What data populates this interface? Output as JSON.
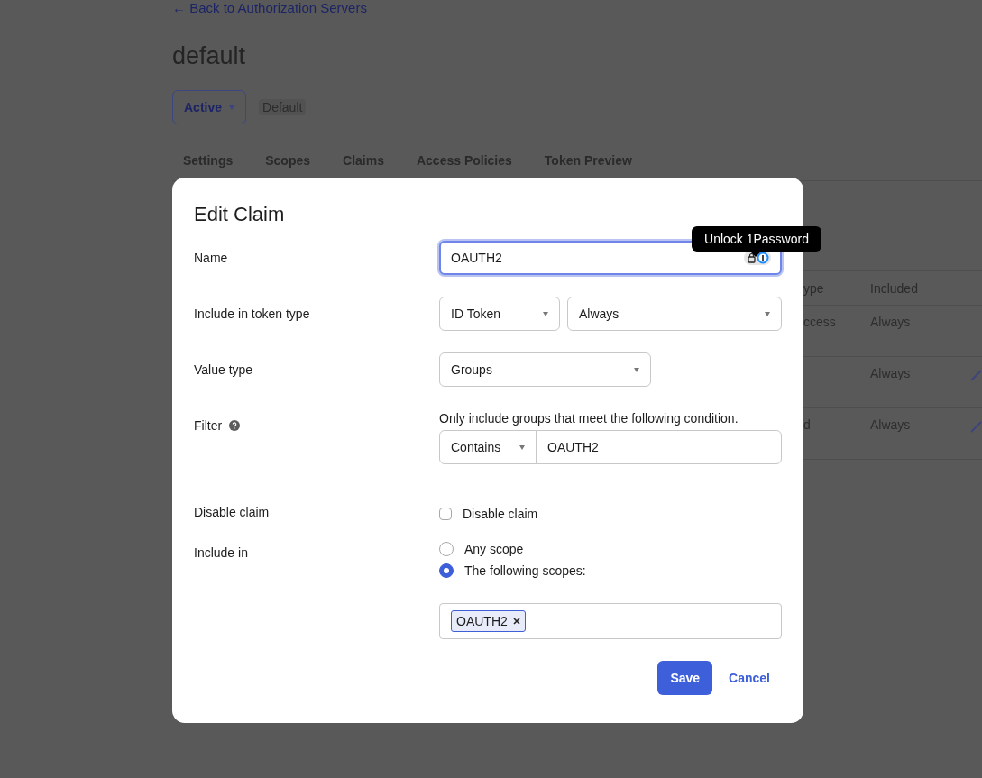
{
  "page": {
    "back_link": "← Back to Authorization Servers",
    "title": "default",
    "status_dropdown": "Active",
    "badge": "Default",
    "tabs": [
      {
        "label": "Settings",
        "selected": false
      },
      {
        "label": "Scopes",
        "selected": false
      },
      {
        "label": "Claims",
        "selected": false
      },
      {
        "label": "Access Policies",
        "selected": false
      },
      {
        "label": "Token Preview",
        "selected": false
      }
    ],
    "table": {
      "columns": [
        "ype",
        "Included"
      ],
      "rows": [
        {
          "column_1": "ccess",
          "included": "Always",
          "edit_icon": false
        },
        {
          "included": "Always",
          "edit_icon": true
        },
        {
          "column_1": "d",
          "included": "Always",
          "edit_icon": true
        }
      ]
    }
  },
  "modal": {
    "title": "Edit Claim",
    "name": {
      "label": "Name",
      "value": "OAUTH2",
      "focused": true
    },
    "token_type": {
      "label": "Include in token type",
      "token": "ID Token",
      "when": "Always"
    },
    "value_type": {
      "label": "Value type",
      "value": "Groups"
    },
    "filter": {
      "label": "Filter",
      "hint": "Only include groups that meet the following condition.",
      "operator": "Contains",
      "value": "OAUTH2"
    },
    "disable_claim": {
      "label": "Disable claim",
      "checkbox_label": "Disable claim",
      "checked": false
    },
    "include_in": {
      "label": "Include in",
      "options": [
        {
          "label": "Any scope",
          "selected": false
        },
        {
          "label": "The following scopes:",
          "selected": true
        }
      ],
      "scopes": [
        "OAUTH2"
      ]
    },
    "buttons": {
      "save": "Save",
      "cancel": "Cancel"
    }
  },
  "tooltip": "Unlock 1Password"
}
